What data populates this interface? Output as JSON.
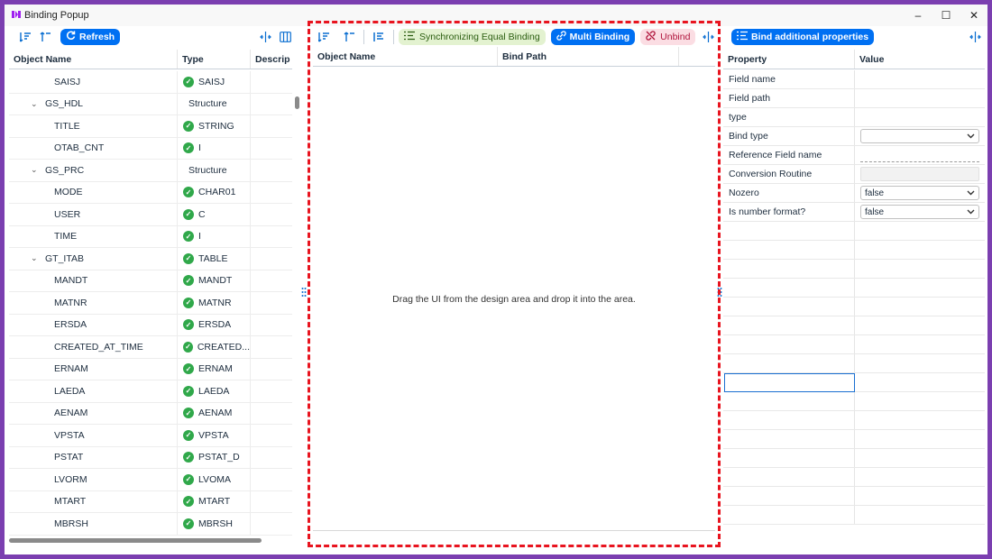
{
  "window": {
    "title": "Binding Popup",
    "logo_icon": "app-logo-icon",
    "minimize": "–",
    "maximize": "☐",
    "close": "✕"
  },
  "left": {
    "refresh_label": "Refresh",
    "columns": [
      "Object Name",
      "Type",
      "Descrip"
    ],
    "rows": [
      {
        "name": "SAISJ",
        "type": "SAISJ",
        "level": 2,
        "check": true
      },
      {
        "name": "GS_HDL",
        "type": "Structure",
        "level": 1,
        "check": false,
        "expanded": true
      },
      {
        "name": "TITLE",
        "type": "STRING",
        "level": 2,
        "check": true
      },
      {
        "name": "OTAB_CNT",
        "type": "I",
        "level": 2,
        "check": true
      },
      {
        "name": "GS_PRC",
        "type": "Structure",
        "level": 1,
        "check": false,
        "expanded": true
      },
      {
        "name": "MODE",
        "type": "CHAR01",
        "level": 2,
        "check": true
      },
      {
        "name": "USER",
        "type": "C",
        "level": 2,
        "check": true
      },
      {
        "name": "TIME",
        "type": "I",
        "level": 2,
        "check": true
      },
      {
        "name": "GT_ITAB",
        "type": "TABLE",
        "level": 1,
        "check": true,
        "expanded": true
      },
      {
        "name": "MANDT",
        "type": "MANDT",
        "level": 2,
        "check": true
      },
      {
        "name": "MATNR",
        "type": "MATNR",
        "level": 2,
        "check": true
      },
      {
        "name": "ERSDA",
        "type": "ERSDA",
        "level": 2,
        "check": true
      },
      {
        "name": "CREATED_AT_TIME",
        "type": "CREATED...",
        "level": 2,
        "check": true
      },
      {
        "name": "ERNAM",
        "type": "ERNAM",
        "level": 2,
        "check": true
      },
      {
        "name": "LAEDA",
        "type": "LAEDA",
        "level": 2,
        "check": true
      },
      {
        "name": "AENAM",
        "type": "AENAM",
        "level": 2,
        "check": true
      },
      {
        "name": "VPSTA",
        "type": "VPSTA",
        "level": 2,
        "check": true
      },
      {
        "name": "PSTAT",
        "type": "PSTAT_D",
        "level": 2,
        "check": true
      },
      {
        "name": "LVORM",
        "type": "LVOMA",
        "level": 2,
        "check": true
      },
      {
        "name": "MTART",
        "type": "MTART",
        "level": 2,
        "check": true
      },
      {
        "name": "MBRSH",
        "type": "MBRSH",
        "level": 2,
        "check": true
      }
    ]
  },
  "middle": {
    "sync_label": "Synchronizing Equal Binding",
    "multi_label": "Multi Binding",
    "unbind_label": "Unbind",
    "columns": [
      "Object Name",
      "Bind Path"
    ],
    "empty_text": "Drag the UI from the design area and drop it into the area."
  },
  "right": {
    "bind_additional_label": "Bind additional properties",
    "columns": [
      "Property",
      "Value"
    ],
    "properties": [
      {
        "label": "Field name",
        "kind": "text",
        "value": ""
      },
      {
        "label": "Field path",
        "kind": "text",
        "value": ""
      },
      {
        "label": "type",
        "kind": "text",
        "value": ""
      },
      {
        "label": "Bind type",
        "kind": "select",
        "value": ""
      },
      {
        "label": "Reference Field name",
        "kind": "dotted",
        "value": ""
      },
      {
        "label": "Conversion Routine",
        "kind": "input",
        "value": ""
      },
      {
        "label": "Nozero",
        "kind": "select",
        "value": "false"
      },
      {
        "label": "Is number format?",
        "kind": "select",
        "value": "false"
      }
    ]
  },
  "colors": {
    "accent": "#0070f2",
    "highlight_border": "#e8141f",
    "frame": "#7b3fb0"
  }
}
